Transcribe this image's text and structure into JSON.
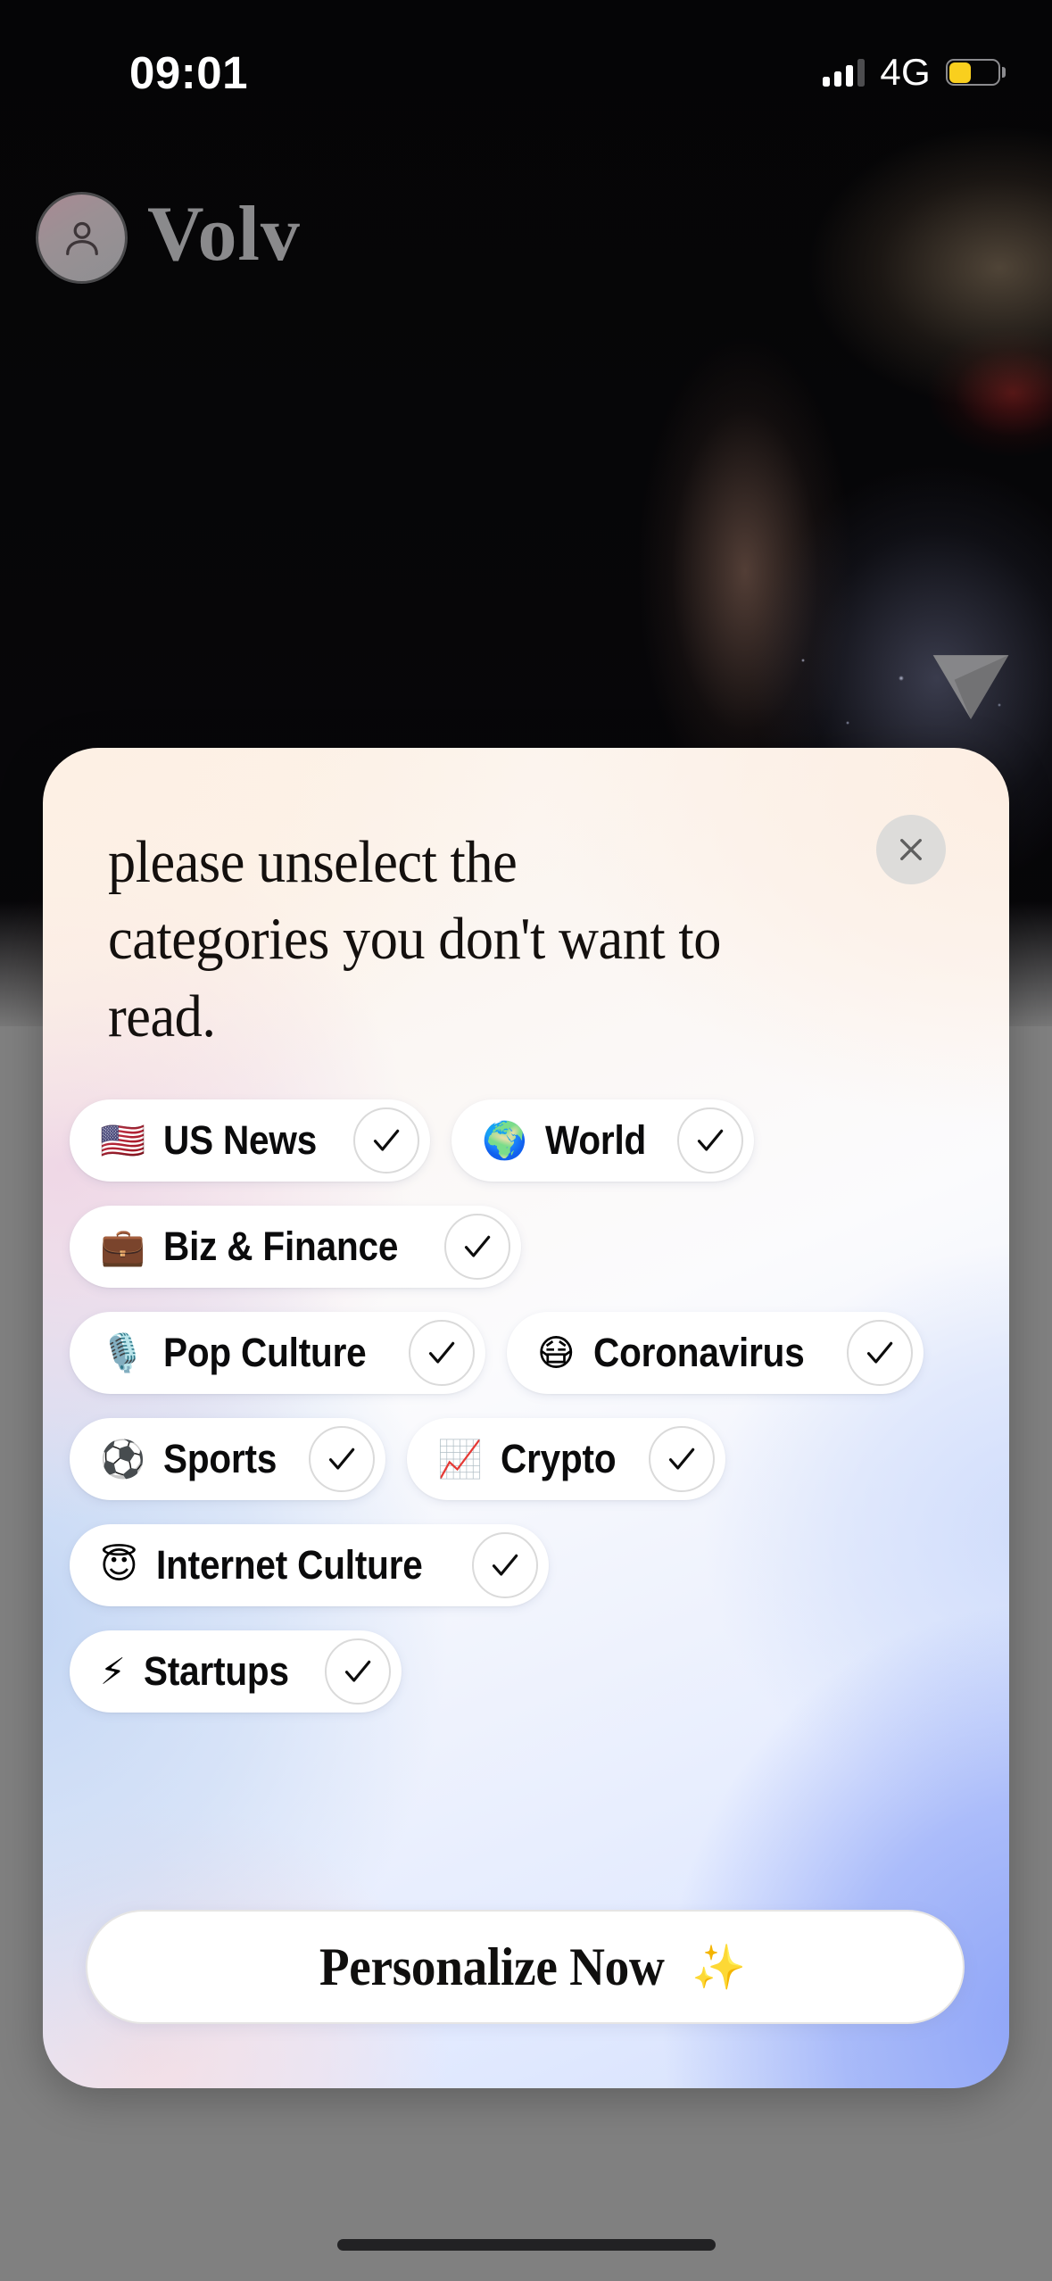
{
  "status_bar": {
    "time": "09:01",
    "network": "4G",
    "signal_icon": "signal-bars-icon",
    "battery_icon": "battery-low-power-icon",
    "battery_fill_color": "#f9cf1e",
    "signal_bars_filled": 3,
    "signal_bars_total": 4
  },
  "app_header": {
    "wordmark": "Volv",
    "avatar_icon": "person-avatar-icon"
  },
  "background": {
    "share_icon": "share-arrow-watermark-icon"
  },
  "modal": {
    "title": "please unselect the categories you don't want to read.",
    "close_icon": "close-x-icon",
    "close_label": "Close",
    "background_gradient": {
      "cream": "#fdf2e8",
      "pink": "#efd7e6",
      "periwinkle": "#8ea4f7",
      "light_blue": "#d5e0fb"
    }
  },
  "categories": {
    "check_icon": "checkmark-icon",
    "rows": [
      [
        {
          "emoji": "🇺🇸",
          "label": "US News",
          "selected": true
        },
        {
          "emoji": "🌍",
          "label": "World",
          "selected": true
        }
      ],
      [
        {
          "emoji": "💼",
          "label": "Biz & Finance",
          "selected": true
        }
      ],
      [
        {
          "emoji": "🎙️",
          "label": "Pop Culture",
          "selected": true
        },
        {
          "emoji": "😷",
          "label": "Coronavirus",
          "selected": true
        }
      ],
      [
        {
          "emoji": "⚽",
          "label": "Sports",
          "selected": true
        },
        {
          "emoji": "📈",
          "label": "Crypto",
          "selected": true
        }
      ],
      [
        {
          "emoji": "😇",
          "label": "Internet Culture",
          "selected": true
        }
      ],
      [
        {
          "emoji": "⚡",
          "label": "Startups",
          "selected": true
        }
      ]
    ]
  },
  "cta": {
    "label": "Personalize Now",
    "sparkle": "✨"
  },
  "system": {
    "home_indicator": "home-indicator"
  }
}
